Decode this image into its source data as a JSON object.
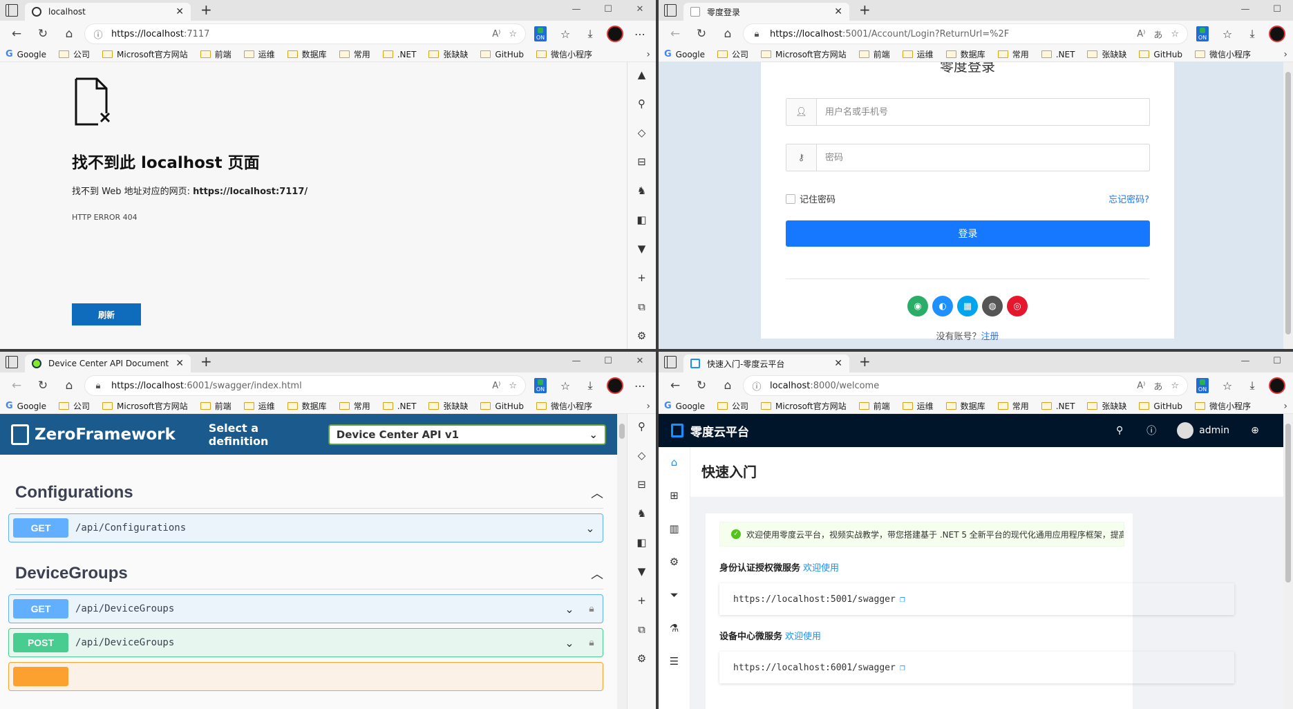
{
  "bookmarks": [
    "Google",
    "公司",
    "Microsoft官方网站",
    "前端",
    "运维",
    "数据库",
    "常用",
    ".NET",
    "张缺缺",
    "GitHub",
    "微信小程序"
  ],
  "windows": {
    "tl": {
      "tab_title": "localhost",
      "url_host": "https://localhost",
      "url_rest": ":7117",
      "error_title": "找不到此 localhost 页面",
      "error_msg_prefix": "找不到 Web 地址对应的网页: ",
      "error_msg_url": "https://localhost:7117/",
      "error_code": "HTTP ERROR 404",
      "refresh_label": "刷新"
    },
    "tr": {
      "tab_title": "零度登录",
      "url_host": "https://localhost",
      "url_rest": ":5001/Account/Login?ReturnUrl=%2F",
      "login_title": "零度登录",
      "username_placeholder": "用户名或手机号",
      "password_placeholder": "密码",
      "remember_label": "记住密码",
      "forgot_label": "忘记密码?",
      "login_label": "登录",
      "register_prefix": "没有账号？",
      "register_link": "注册"
    },
    "bl": {
      "tab_title": "Device Center API Document",
      "url_host": "https://localhost",
      "url_rest": ":6001/swagger/index.html",
      "logo_text": "ZeroFramework",
      "definition_label": "Select a definition",
      "definition_value": "Device Center API v1",
      "sections": [
        {
          "name": "Configurations",
          "ops": [
            {
              "method": "GET",
              "path": "/api/Configurations"
            }
          ]
        },
        {
          "name": "DeviceGroups",
          "ops": [
            {
              "method": "GET",
              "path": "/api/DeviceGroups"
            },
            {
              "method": "POST",
              "path": "/api/DeviceGroups"
            }
          ]
        }
      ]
    },
    "br": {
      "tab_title": "快速入门-零度云平台",
      "url_host": "localhost",
      "url_rest": ":8000/welcome",
      "app_name": "零度云平台",
      "user_name": "admin",
      "page_title": "快速入门",
      "alert": "欢迎使用零度云平台，视频实战教学，带您搭建基于 .NET 5 全新平台的现代化通用应用程序框架，提高生产效率。",
      "services": [
        {
          "name": "身份认证授权微服务",
          "link": "欢迎使用",
          "url": "https://localhost:5001/swagger"
        },
        {
          "name": "设备中心微服务",
          "link": "欢迎使用",
          "url": "https://localhost:6001/swagger"
        }
      ]
    }
  },
  "colors": {
    "accent_blue": "#1677ff",
    "swagger_header": "#1b5a8c",
    "get": "#61affe",
    "post": "#49cc90",
    "dark_header": "#001529"
  }
}
